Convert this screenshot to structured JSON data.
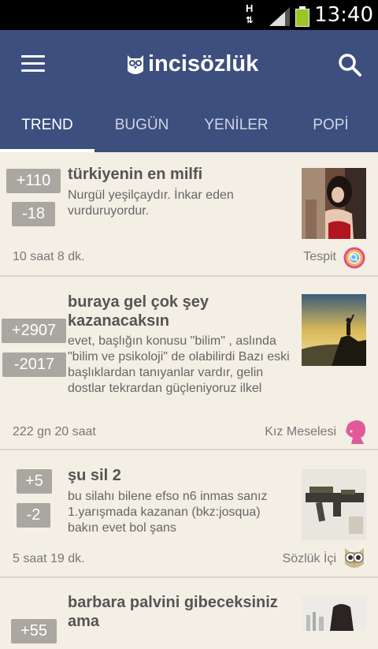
{
  "status": {
    "time": "13:40",
    "network": "H"
  },
  "appbar": {
    "logo_text": "incisözlük"
  },
  "tabs": [
    {
      "label": "TREND"
    },
    {
      "label": "BUGÜN"
    },
    {
      "label": "YENİLER"
    },
    {
      "label": "POPİ"
    }
  ],
  "entries": [
    {
      "upvotes": "+110",
      "downvotes": "-18",
      "title": "türkiyenin en milfi",
      "excerpt": "Nurgül yeşilçaydır. İnkar eden vurduruyordur.",
      "time": "10 saat 8 dk.",
      "category": "Tespit"
    },
    {
      "upvotes": "+2907",
      "downvotes": "-2017",
      "title": "buraya gel çok şey kazanacaksın",
      "excerpt": "evet, başlığın konusu \"bilim\" , aslında \"bilim ve psikoloji\" de olabilirdi Bazı eski başlıklardan tanıyanlar vardır, gelin dostlar tekrardan güçleniyoruz ilkel",
      "time": "222 gn 20 saat",
      "category": "Kız Meselesi"
    },
    {
      "upvotes": "+5",
      "downvotes": "-2",
      "title": "şu sil 2",
      "excerpt": "bu silahı bilene efso n6 inmas sanız 1.yarışmada kazanan (bkz:josqua) bakın evet bol şans",
      "time": "5 saat 19 dk.",
      "category": "Sözlük İçi"
    },
    {
      "upvotes": "+55",
      "downvotes": "",
      "title": "barbara palvini gibeceksiniz ama",
      "excerpt": "",
      "time": "",
      "category": ""
    }
  ]
}
